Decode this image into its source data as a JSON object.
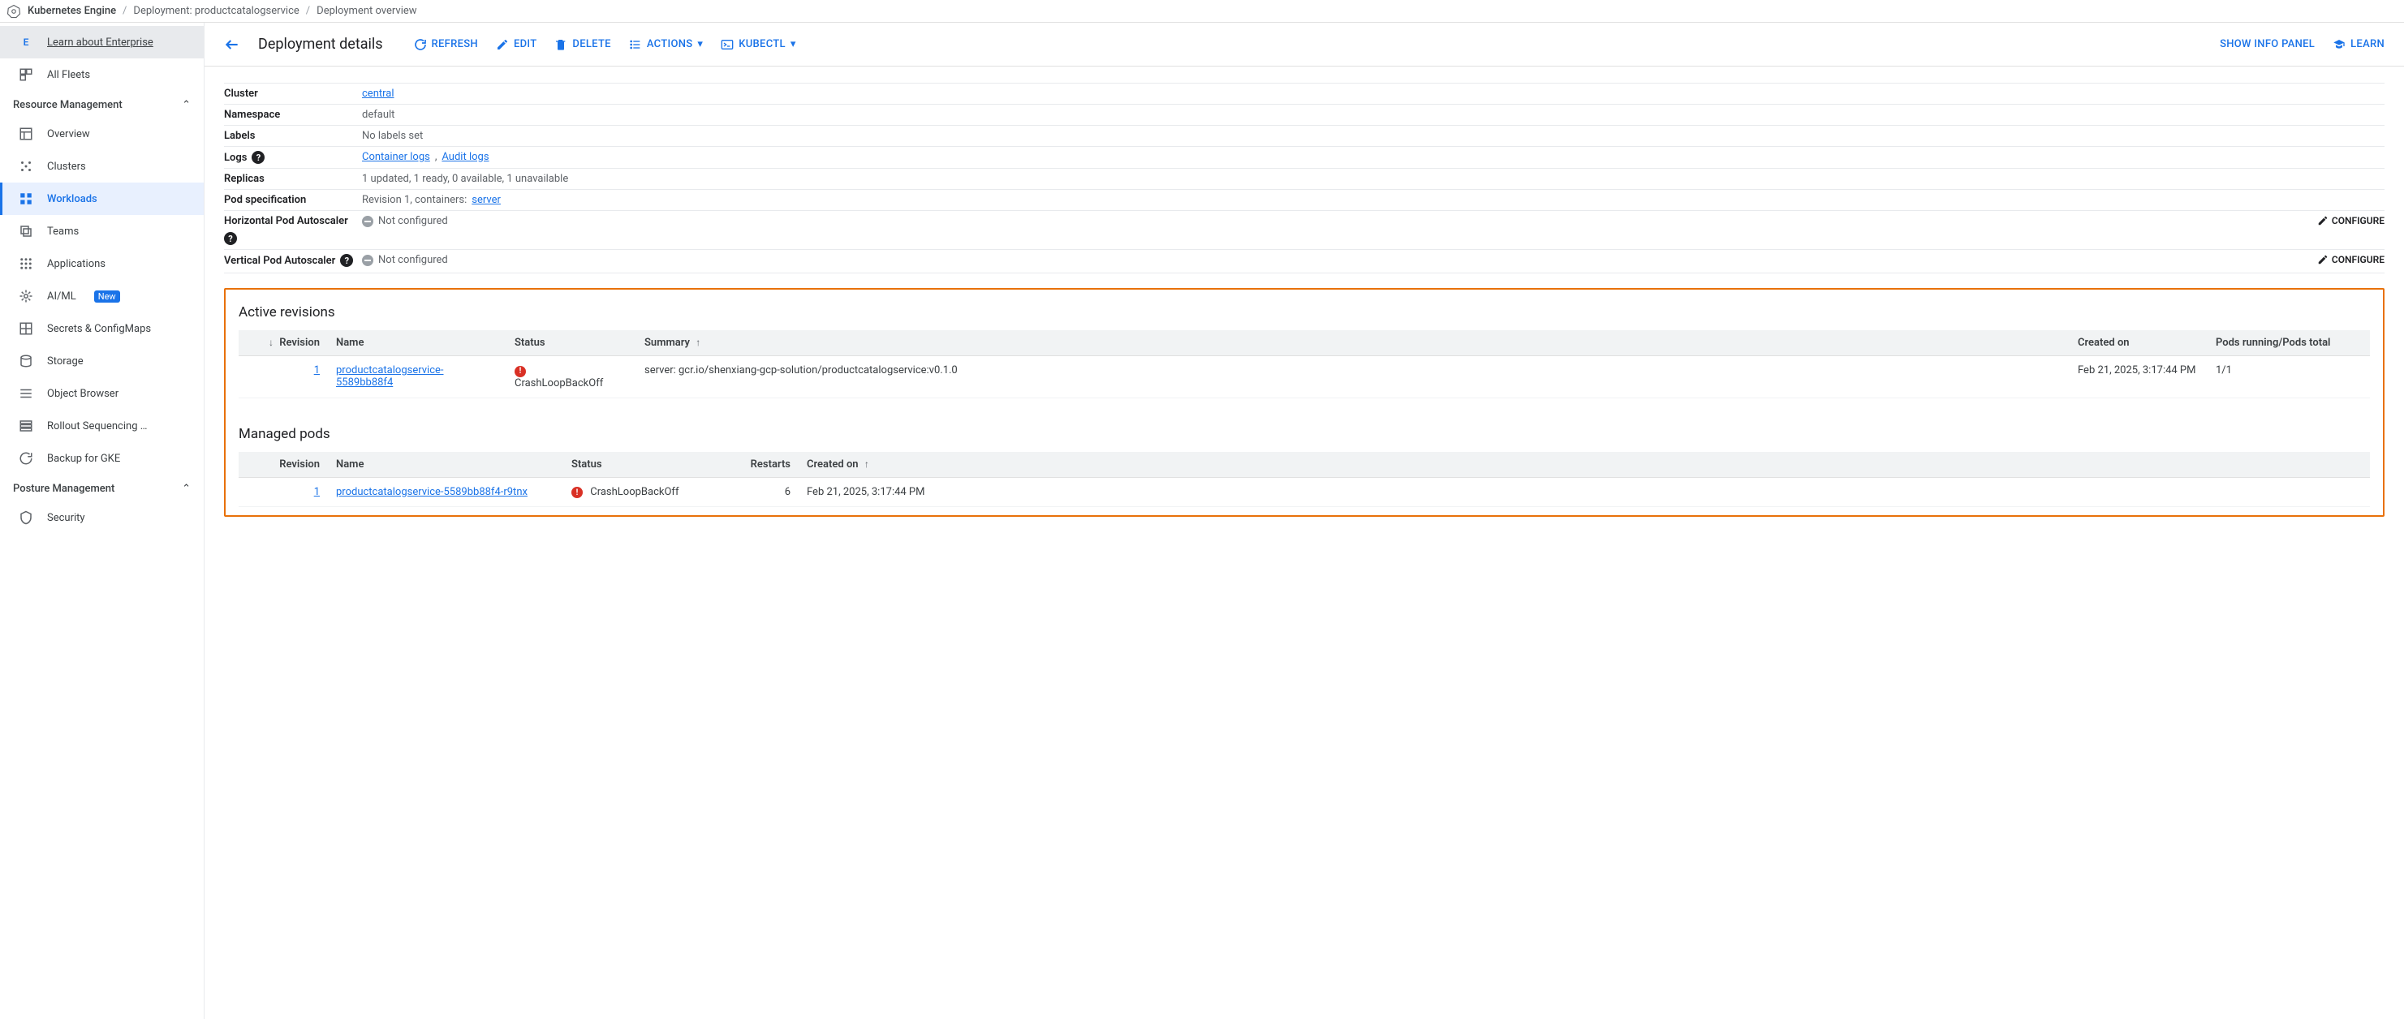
{
  "breadcrumb": {
    "service": "Kubernetes Engine",
    "deployment_prefix": "Deployment:",
    "deployment_name": "productcatalogservice",
    "page": "Deployment overview"
  },
  "sidebar": {
    "enterprise": "Learn about Enterprise",
    "all_fleets": "All Fleets",
    "resource_mgmt_header": "Resource Management",
    "items": {
      "overview": "Overview",
      "clusters": "Clusters",
      "workloads": "Workloads",
      "teams": "Teams",
      "applications": "Applications",
      "aiml": "AI/ML",
      "aiml_badge": "New",
      "secrets": "Secrets & ConfigMaps",
      "storage": "Storage",
      "object_browser": "Object Browser",
      "rollout": "Rollout Sequencing …",
      "backup": "Backup for GKE"
    },
    "posture_header": "Posture Management",
    "posture": {
      "security": "Security"
    }
  },
  "header": {
    "title": "Deployment details",
    "refresh": "REFRESH",
    "edit": "EDIT",
    "delete": "DELETE",
    "actions": "ACTIONS",
    "kubectl": "KUBECTL",
    "info_panel": "SHOW INFO PANEL",
    "learn": "LEARN"
  },
  "kv": {
    "cluster_k": "Cluster",
    "cluster_v": "central",
    "ns_k": "Namespace",
    "ns_v": "default",
    "labels_k": "Labels",
    "labels_v": "No labels set",
    "logs_k": "Logs",
    "logs_container": "Container logs",
    "logs_audit": "Audit logs",
    "replicas_k": "Replicas",
    "replicas_v": "1 updated, 1 ready, 0 available, 1 unavailable",
    "podspec_k": "Pod specification",
    "podspec_prefix": "Revision 1, containers:",
    "podspec_link": "server",
    "hpa_k": "Horizontal Pod Autoscaler",
    "hpa_v": "Not configured",
    "vpa_k": "Vertical Pod Autoscaler",
    "vpa_v": "Not configured",
    "configure": "CONFIGURE"
  },
  "revisions": {
    "title": "Active revisions",
    "cols": {
      "revision": "Revision",
      "name": "Name",
      "status": "Status",
      "summary": "Summary",
      "created": "Created on",
      "pods": "Pods running/Pods total"
    },
    "row": {
      "revision": "1",
      "name": "productcatalogservice-5589bb88f4",
      "status": "CrashLoopBackOff",
      "summary": "server: gcr.io/shenxiang-gcp-solution/productcatalogservice:v0.1.0",
      "created": "Feb 21, 2025, 3:17:44 PM",
      "pods": "1/1"
    }
  },
  "pods": {
    "title": "Managed pods",
    "cols": {
      "revision": "Revision",
      "name": "Name",
      "status": "Status",
      "restarts": "Restarts",
      "created": "Created on"
    },
    "row": {
      "revision": "1",
      "name": "productcatalogservice-5589bb88f4-r9tnx",
      "status": "CrashLoopBackOff",
      "restarts": "6",
      "created": "Feb 21, 2025, 3:17:44 PM"
    }
  }
}
